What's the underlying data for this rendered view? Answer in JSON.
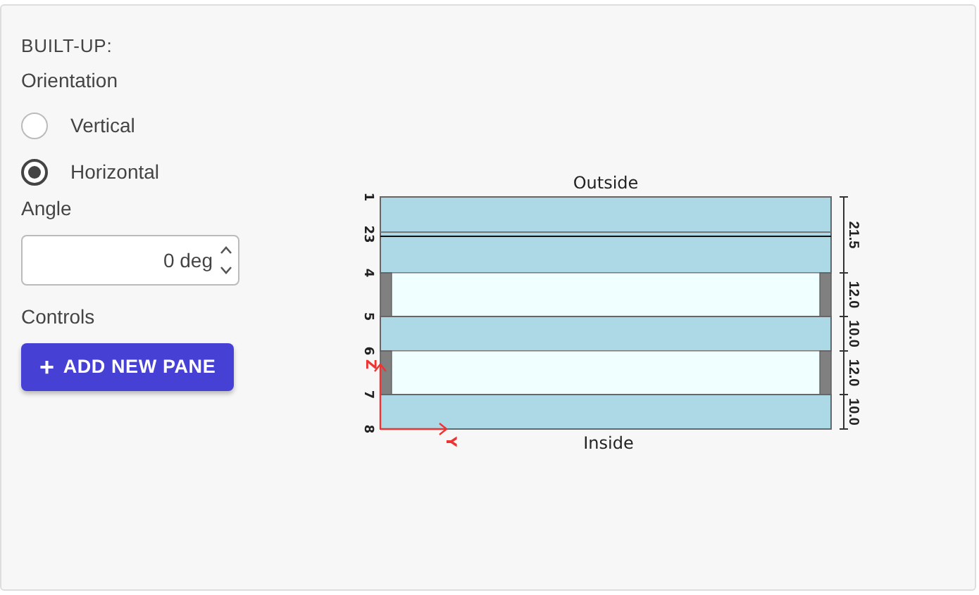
{
  "section_title": "BUILT-UP:",
  "orientation": {
    "label": "Orientation",
    "options": [
      {
        "label": "Vertical",
        "selected": false
      },
      {
        "label": "Horizontal",
        "selected": true
      }
    ]
  },
  "angle": {
    "label": "Angle",
    "value": "0 deg"
  },
  "controls": {
    "label": "Controls",
    "button": "ADD NEW PANE",
    "button_icon": "+"
  },
  "diagram": {
    "top_label": "Outside",
    "bottom_label": "Inside",
    "layers": [
      {
        "kind": "laminated",
        "dimension": "21.5"
      },
      {
        "kind": "gap",
        "dimension": "12.0"
      },
      {
        "kind": "glass",
        "dimension": "10.0"
      },
      {
        "kind": "gap",
        "dimension": "12.0"
      },
      {
        "kind": "glass",
        "dimension": "10.0"
      }
    ],
    "boundary_labels": [
      "1",
      "23",
      "4",
      "5",
      "6",
      "7",
      "8"
    ],
    "axes": {
      "vertical": "Z",
      "horizontal": "Y"
    }
  }
}
